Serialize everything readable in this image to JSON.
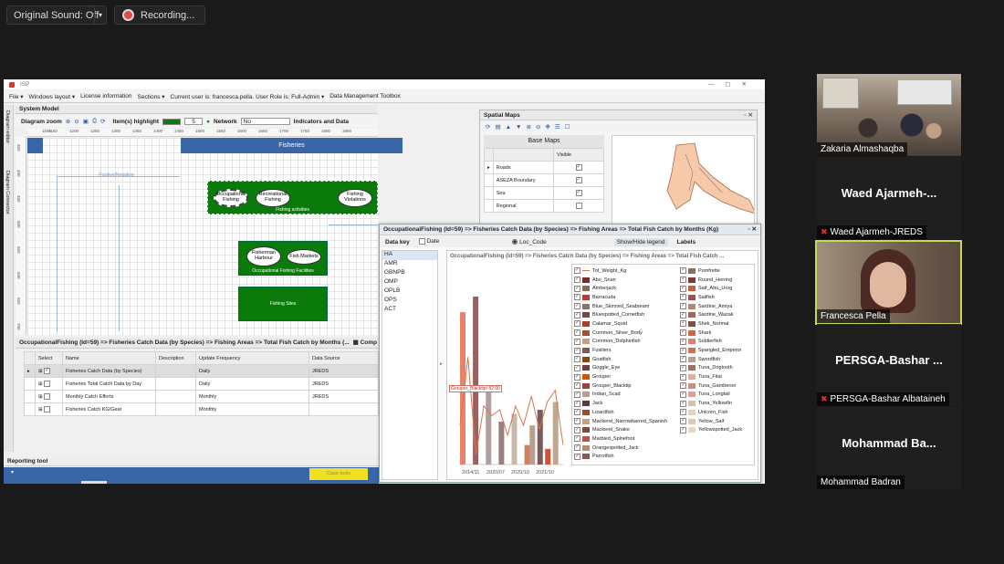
{
  "meeting": {
    "sound_label": "Original Sound: Off",
    "recording_label": "Recording..."
  },
  "participants": [
    {
      "name": "Zakaria Almashaqba",
      "big": "",
      "muted": false
    },
    {
      "name": "Waed Ajarmeh-JREDS",
      "big": "Waed  Ajarmeh-...",
      "muted": true
    },
    {
      "name": "Francesca Pella",
      "big": "",
      "muted": false
    },
    {
      "name": "PERSGA-Bashar Albataineh",
      "big": "PERSGA-Bashar ...",
      "muted": true
    },
    {
      "name": "Mohammad Badran",
      "big": "Mohammad  Ba...",
      "muted": false
    }
  ],
  "app": {
    "title": "ISP",
    "menu": [
      "File ▾",
      "Windows layout ▾",
      "License information",
      "Sections ▾",
      "Current user is: francesca.pella. User Role is: Full-Admin ▾",
      "Data Management Toolbox"
    ],
    "side_tabs": [
      "Diagram editor",
      "Diagram Connector"
    ]
  },
  "system_model": {
    "title": "System Model",
    "zoom_label": "Diagram zoom",
    "highlight_label": "Item(s) highlight",
    "highlight_value": "5",
    "network_label": "Network",
    "network_value": "No",
    "indicators_label": "Indicators and Data",
    "ruler": [
      "1100",
      "1150",
      "1200",
      "1250",
      "1300",
      "1350",
      "1400",
      "1450",
      "1500",
      "1550",
      "1600",
      "1650",
      "1700",
      "1750",
      "1800",
      "1850",
      "1900",
      "1950"
    ],
    "vruler": [
      "350",
      "400",
      "450",
      "500",
      "550",
      "600",
      "650",
      "700"
    ],
    "fisheries_header": "Fisheries",
    "link_label": "Positive/Negative",
    "activities_label": "Fishing activities",
    "nodes": [
      "Occupational Fishing",
      "Recreational Fishing",
      "Fishing Violations"
    ],
    "facilities_label": "Occupational Fishing Facilities",
    "facility_nodes": [
      "Fisherman Harbour",
      "Fish Markets"
    ],
    "sites_label": "Fishing Sites"
  },
  "catch_table": {
    "title": "OccupationalFishing (Id=59) => Fisheries Catch Data (by Species) => Fishing Areas => Total Fish Catch by Months (...",
    "compare_label": "Comp",
    "headers": [
      "Select",
      "Name",
      "Description",
      "Update Frequency",
      "Data Source"
    ],
    "rows": [
      {
        "name": "Fisheries Catch Data (by Species)",
        "desc": "",
        "freq": "Daily",
        "source": "JREDS",
        "checked": true
      },
      {
        "name": "Fisheries Total Catch Data by Day",
        "desc": "",
        "freq": "Daily",
        "source": "JREDS",
        "checked": false
      },
      {
        "name": "Monthly Catch Efforts",
        "desc": "",
        "freq": "Monthly",
        "source": "JREDS",
        "checked": false
      },
      {
        "name": "Fisheries Catch KG/Gear",
        "desc": "",
        "freq": "Monthly",
        "source": "",
        "checked": false
      }
    ]
  },
  "reporting": {
    "title": "Reporting tool",
    "button": "Case tools"
  },
  "spatial": {
    "title": "Spatial Maps",
    "base_maps": "Base Maps",
    "visible_header": "Visible",
    "layers": [
      {
        "name": "Roads",
        "visible": true
      },
      {
        "name": "ASEZA Boundary",
        "visible": true
      },
      {
        "name": "Sea",
        "visible": true
      },
      {
        "name": "Regional",
        "visible": false
      }
    ]
  },
  "chart_window": {
    "title": "OccupationalFishing (Id=59) => Fisheries Catch Data (by Species) => Fishing Areas => Total Fish Catch by Months (Kg)",
    "data_key_label": "Data key",
    "date_label": "Date",
    "loc_label": "Loc_Code",
    "show_legend": "Show/Hide legend",
    "labels": "Labels",
    "keys": [
      "HA",
      "AMR",
      "GBNPB",
      "OMP",
      "OPLB",
      "OPS",
      "ACT"
    ],
    "chart_title": "OccupationalFishing (Id=59) => Fisheries Catch Data (by Species) => Fishing Areas => Total Fish Catch ...",
    "tooltip": "Grouper_Blacktip/ 82.00"
  },
  "chart_data": {
    "type": "bar",
    "categories": [
      "2014/11",
      "2020/07",
      "2020/10",
      "2021/10"
    ],
    "series_note": "",
    "legend_left": [
      {
        "name": "Tot_Weight_Kg",
        "color": "#d9744a",
        "line": true
      },
      {
        "name": "Abo_Snan",
        "color": "#7a2a2a"
      },
      {
        "name": "Amberjack",
        "color": "#8c6a5a"
      },
      {
        "name": "Barracuda",
        "color": "#c0392b"
      },
      {
        "name": "Blue_Skinned_Seabream",
        "color": "#8a7070"
      },
      {
        "name": "Bluespotted_Cornetfish",
        "color": "#6e4a4a"
      },
      {
        "name": "Calamar_Squid",
        "color": "#b03a2e"
      },
      {
        "name": "Common_Silver_Body",
        "color": "#a0522d"
      },
      {
        "name": "Common_Dolphinfish",
        "color": "#c8a080"
      },
      {
        "name": "Fusiliers",
        "color": "#7b5b5b"
      },
      {
        "name": "Goatfish",
        "color": "#8b4513"
      },
      {
        "name": "Goggle_Eye",
        "color": "#6b4040"
      },
      {
        "name": "Grouper",
        "color": "#d35400"
      },
      {
        "name": "Grouper_Blacktip",
        "color": "#a04040"
      },
      {
        "name": "Indian_Scad",
        "color": "#b5a08a"
      },
      {
        "name": "Jack",
        "color": "#5a3a3a"
      },
      {
        "name": "Lizardfish",
        "color": "#9e4a3a"
      },
      {
        "name": "Mackerel_Narrowbarred_Spanish",
        "color": "#caa27a"
      },
      {
        "name": "Mackerel_Snake",
        "color": "#7a4a3a"
      },
      {
        "name": "Marbled_Spinefoot",
        "color": "#c0504d"
      },
      {
        "name": "Orangespotted_Jack",
        "color": "#b09070"
      },
      {
        "name": "Parrotfish",
        "color": "#8a5a5a"
      }
    ],
    "legend_right": [
      {
        "name": "Pomfrette",
        "color": "#8a7060"
      },
      {
        "name": "Round_Herring",
        "color": "#7a3a3a"
      },
      {
        "name": "Saif_Abu_Urog",
        "color": "#c06040"
      },
      {
        "name": "Sailfish",
        "color": "#a05050"
      },
      {
        "name": "Sardine_Amiya",
        "color": "#b08a70"
      },
      {
        "name": "Sardine_Wazak",
        "color": "#9a6a5a"
      },
      {
        "name": "Shek_Normal",
        "color": "#7a5050"
      },
      {
        "name": "Shark",
        "color": "#c86a4a"
      },
      {
        "name": "Soldierfish",
        "color": "#e08070"
      },
      {
        "name": "Spangled_Emperor",
        "color": "#d07050"
      },
      {
        "name": "Swordfish",
        "color": "#b8a090"
      },
      {
        "name": "Tuna_Dogtooth",
        "color": "#a07060"
      },
      {
        "name": "Tuna_Fital",
        "color": "#d9b0a0"
      },
      {
        "name": "Tuna_Gamberon",
        "color": "#c89080"
      },
      {
        "name": "Tuna_Longtail",
        "color": "#e0a090"
      },
      {
        "name": "Tuna_Yellowfin",
        "color": "#d8c0b0"
      },
      {
        "name": "Unicorn_Fish",
        "color": "#e8d0c0"
      },
      {
        "name": "Yellow_Saif",
        "color": "#e0c8b0"
      },
      {
        "name": "Yellowspotted_Jack",
        "color": "#ead8c8"
      }
    ],
    "bars": [
      {
        "x": 0,
        "value": 0.78,
        "color": "#e8836a"
      },
      {
        "x": 0.5,
        "value": 0.86,
        "color": "#9a6060"
      },
      {
        "x": 1,
        "value": 0.38,
        "color": "#b0a0a0"
      },
      {
        "x": 1.5,
        "value": 0.22,
        "color": "#9a8080"
      },
      {
        "x": 2,
        "value": 0.26,
        "color": "#c8b8a8"
      },
      {
        "x": 2.5,
        "value": 0.1,
        "color": "#d08060"
      },
      {
        "x": 2.7,
        "value": 0.2,
        "color": "#b8a090"
      },
      {
        "x": 3,
        "value": 0.28,
        "color": "#7a5a5a"
      },
      {
        "x": 3.3,
        "value": 0.08,
        "color": "#d0503a"
      },
      {
        "x": 3.6,
        "value": 0.32,
        "color": "#c0a890"
      }
    ],
    "line": [
      0.2,
      0.55,
      0.05,
      0.3,
      0.25,
      0.28,
      0.15,
      0.3,
      0.2,
      0.35,
      0.18,
      0.32,
      0.38,
      0.1
    ],
    "xlabel": "",
    "ylabel": ""
  }
}
